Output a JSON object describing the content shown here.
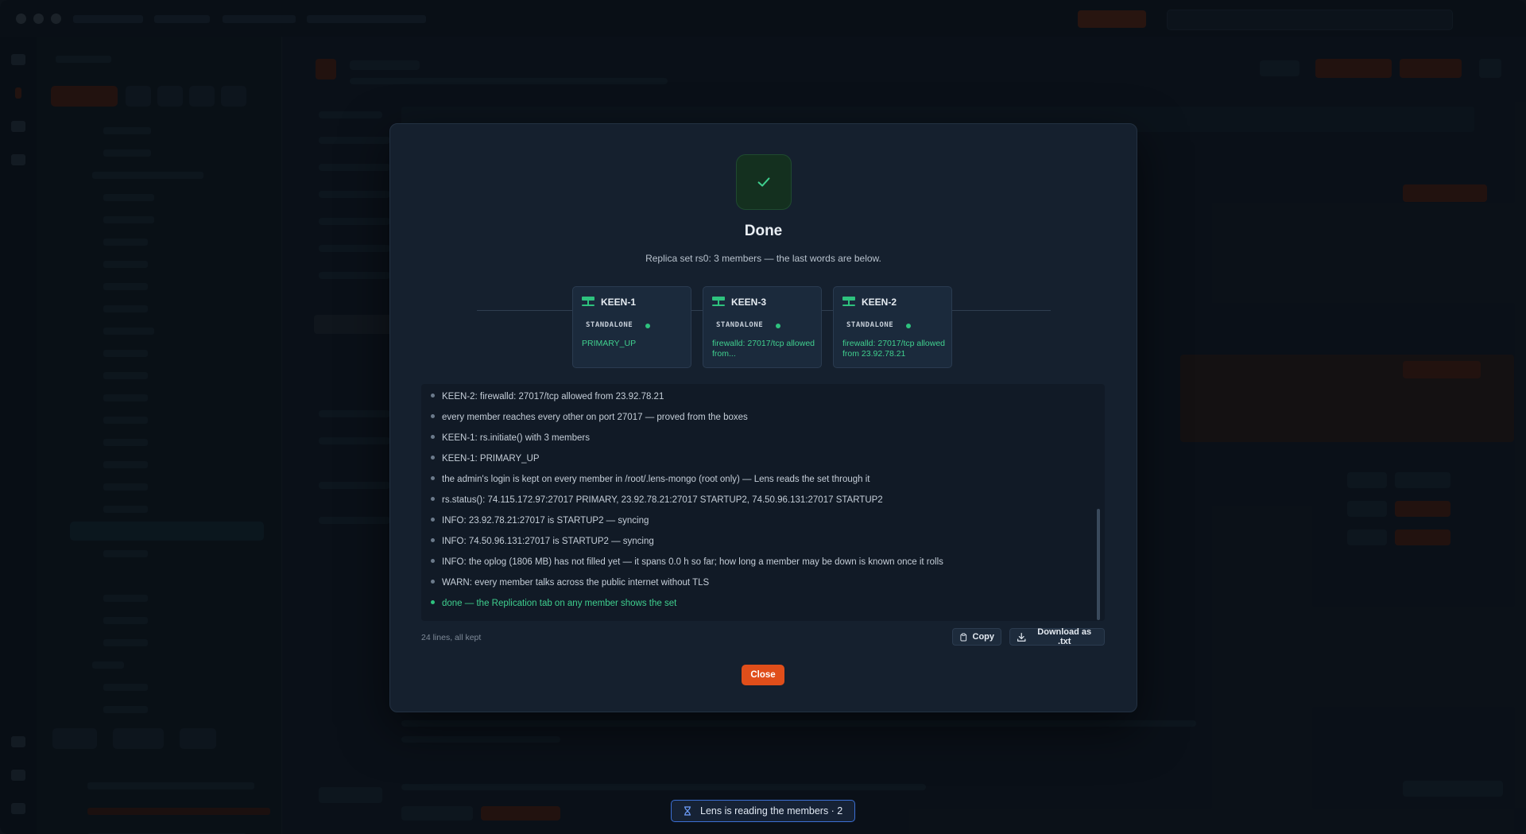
{
  "dialog": {
    "title": "Done",
    "subtitle": "Replica set rs0: 3 members — the last words are below.",
    "members": [
      {
        "name": "KEEN-1",
        "role": "STANDALONE",
        "state": "PRIMARY_UP"
      },
      {
        "name": "KEEN-3",
        "role": "STANDALONE",
        "state": "firewalld: 27017/tcp allowed from..."
      },
      {
        "name": "KEEN-2",
        "role": "STANDALONE",
        "state": "firewalld: 27017/tcp allowed from 23.92.78.21"
      }
    ],
    "log_lines": [
      "KEEN-2: firewalld: 27017/tcp allowed from 23.92.78.21",
      "every member reaches every other on port 27017 — proved from the boxes",
      "KEEN-1: rs.initiate() with 3 members",
      "KEEN-1: PRIMARY_UP",
      "the admin's login is kept on every member in /root/.lens-mongo (root only) — Lens reads the set through it",
      "rs.status(): 74.115.172.97:27017 PRIMARY, 23.92.78.21:27017 STARTUP2, 74.50.96.131:27017 STARTUP2",
      "INFO: 23.92.78.21:27017 is STARTUP2 — syncing",
      "INFO: 74.50.96.131:27017 is STARTUP2 — syncing",
      "INFO: the oplog (1806 MB) has not filled yet — it spans 0.0 h so far; how long a member may be down is known once it rolls",
      "WARN: every member talks across the public internet without TLS",
      "done — the Replication tab on any member shows the set"
    ],
    "line_count": "24 lines, all kept",
    "copy_label": "Copy",
    "download_label": "Download as .txt",
    "close_label": "Close"
  },
  "toast": {
    "text": "Lens is reading the members · 2"
  },
  "colors": {
    "accent_orange": "#e04e1a",
    "success_green": "#2ec27e",
    "toast_border": "#3b6fd4"
  },
  "icons": [
    "check-icon",
    "server-icon",
    "clipboard-icon",
    "download-icon",
    "hourglass-icon"
  ]
}
